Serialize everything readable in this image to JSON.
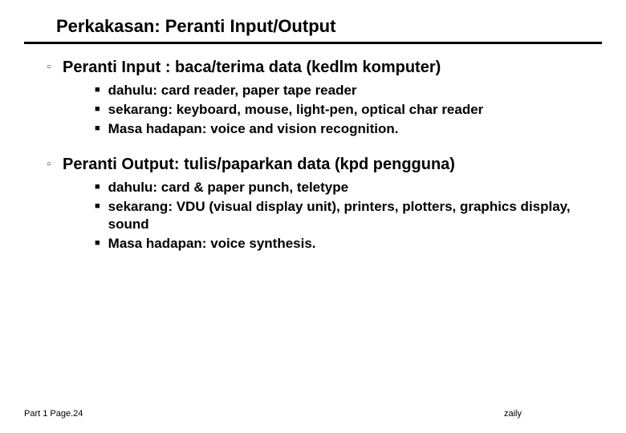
{
  "title": "Perkakasan: Peranti Input/Output",
  "sections": [
    {
      "heading": "Peranti Input : baca/terima data (kedlm komputer)",
      "items": [
        "dahulu: card reader, paper tape reader",
        "sekarang: keyboard, mouse, light-pen, optical char reader",
        "Masa hadapan: voice and vision recognition."
      ]
    },
    {
      "heading": "Peranti Output: tulis/paparkan data (kpd pengguna)",
      "items": [
        "dahulu: card & paper punch, teletype",
        "sekarang: VDU (visual display unit), printers, plotters, graphics display, sound",
        "Masa hadapan: voice synthesis."
      ]
    }
  ],
  "footer": {
    "left": "Part 1 Page.24",
    "right": "zaily"
  }
}
